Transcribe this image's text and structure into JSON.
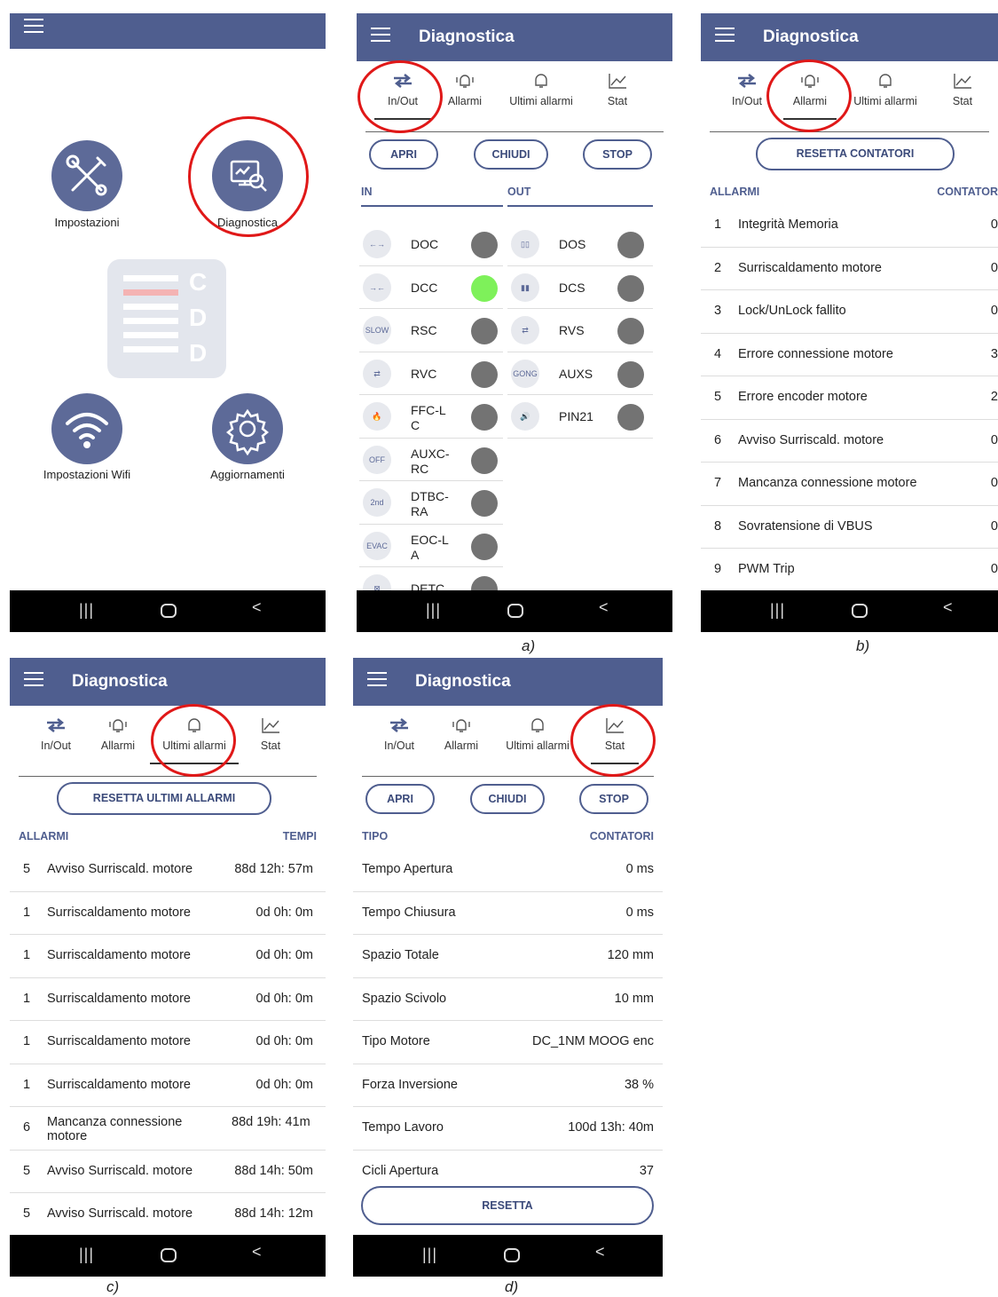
{
  "colors": {
    "appbar": "#4f5e8f",
    "accent": "#3b4a7a",
    "dot_off": "#737373",
    "dot_on": "#7ef15a",
    "highlight_circle": "#e01818"
  },
  "home": {
    "items": [
      {
        "label": "Impostazioni",
        "icon": "tools-icon"
      },
      {
        "label": "Diagnostica",
        "icon": "diagnostics-monitor-icon"
      },
      {
        "label": "Impostazioni Wifi",
        "icon": "wifi-icon"
      },
      {
        "label": "Aggiornamenti",
        "icon": "gear-icon"
      }
    ],
    "logo_letters": [
      "C",
      "D",
      "D"
    ]
  },
  "diag_title": "Diagnostica",
  "tabs": [
    "In/Out",
    "Allarmi",
    "Ultimi allarmi",
    "Stat"
  ],
  "buttons": {
    "apri": "APRI",
    "chiudi": "CHIUDI",
    "stop": "STOP",
    "resetta_contatori": "RESETTA CONTATORI",
    "resetta_ultimi": "RESETTA ULTIMI ALLARMI",
    "resetta": "RESETTA"
  },
  "io": {
    "in_header": "IN",
    "out_header": "OUT",
    "inputs": [
      {
        "name": "DOC",
        "icon": "←→",
        "on": false
      },
      {
        "name": "DCC",
        "icon": "→←",
        "on": true
      },
      {
        "name": "RSC",
        "icon": "SLOW",
        "on": false
      },
      {
        "name": "RVC",
        "icon": "⇄",
        "on": false
      },
      {
        "name": "FFC-L C",
        "icon": "🔥",
        "on": false
      },
      {
        "name": "AUXC-RC",
        "icon": "OFF",
        "on": false
      },
      {
        "name": "DTBC-RA",
        "icon": "2nd",
        "on": false
      },
      {
        "name": "EOC-L A",
        "icon": "EVAC",
        "on": false
      },
      {
        "name": "DETC",
        "icon": "⊠",
        "on": false
      }
    ],
    "outputs": [
      {
        "name": "DOS",
        "icon": "▯▯",
        "on": false
      },
      {
        "name": "DCS",
        "icon": "▮▮",
        "on": false
      },
      {
        "name": "RVS",
        "icon": "⇄",
        "on": false
      },
      {
        "name": "AUXS",
        "icon": "GONG",
        "on": false
      },
      {
        "name": "PIN21",
        "icon": "🔊",
        "on": false
      }
    ]
  },
  "allarmi": {
    "col_left": "ALLARMI",
    "col_right": "CONTATOR",
    "rows": [
      {
        "n": "1",
        "label": "Integrità Memoria",
        "value": "0"
      },
      {
        "n": "2",
        "label": "Surriscaldamento motore",
        "value": "0"
      },
      {
        "n": "3",
        "label": "Lock/UnLock fallito",
        "value": "0"
      },
      {
        "n": "4",
        "label": "Errore connessione motore",
        "value": "3"
      },
      {
        "n": "5",
        "label": "Errore encoder motore",
        "value": "2"
      },
      {
        "n": "6",
        "label": "Avviso Surriscald. motore",
        "value": "0"
      },
      {
        "n": "7",
        "label": "Mancanza connessione motore",
        "value": "0"
      },
      {
        "n": "8",
        "label": "Sovratensione di VBUS",
        "value": "0"
      },
      {
        "n": "9",
        "label": "PWM Trip",
        "value": "0"
      }
    ]
  },
  "ultimi": {
    "col_left": "ALLARMI",
    "col_right": "TEMPI",
    "rows": [
      {
        "n": "5",
        "label": "Avviso Surriscald. motore",
        "value": "88d 12h: 57m"
      },
      {
        "n": "1",
        "label": "Surriscaldamento motore",
        "value": "0d 0h: 0m"
      },
      {
        "n": "1",
        "label": "Surriscaldamento motore",
        "value": "0d 0h: 0m"
      },
      {
        "n": "1",
        "label": "Surriscaldamento motore",
        "value": "0d 0h: 0m"
      },
      {
        "n": "1",
        "label": "Surriscaldamento motore",
        "value": "0d 0h: 0m"
      },
      {
        "n": "1",
        "label": "Surriscaldamento motore",
        "value": "0d 0h: 0m"
      },
      {
        "n": "6",
        "label": "Mancanza connessione motore",
        "value": "88d 19h: 41m"
      },
      {
        "n": "5",
        "label": "Avviso Surriscald. motore",
        "value": "88d 14h: 50m"
      },
      {
        "n": "5",
        "label": "Avviso Surriscald. motore",
        "value": "88d 14h: 12m"
      }
    ]
  },
  "stat": {
    "col_left": "TIPO",
    "col_right": "CONTATORI",
    "rows": [
      {
        "label": "Tempo Apertura",
        "value": "0 ms"
      },
      {
        "label": "Tempo Chiusura",
        "value": "0 ms"
      },
      {
        "label": "Spazio Totale",
        "value": "120 mm"
      },
      {
        "label": "Spazio Scivolo",
        "value": "10 mm"
      },
      {
        "label": "Tipo Motore",
        "value": "DC_1NM MOOG enc"
      },
      {
        "label": "Forza Inversione",
        "value": "38 %"
      },
      {
        "label": "Tempo Lavoro",
        "value": "100d 13h: 40m"
      },
      {
        "label": "Cicli Apertura",
        "value": "37"
      }
    ]
  },
  "captions": {
    "a": "a)",
    "b": "b)",
    "c": "c)",
    "d": "d)"
  },
  "nav": {
    "recent": "|||",
    "back": "<"
  }
}
